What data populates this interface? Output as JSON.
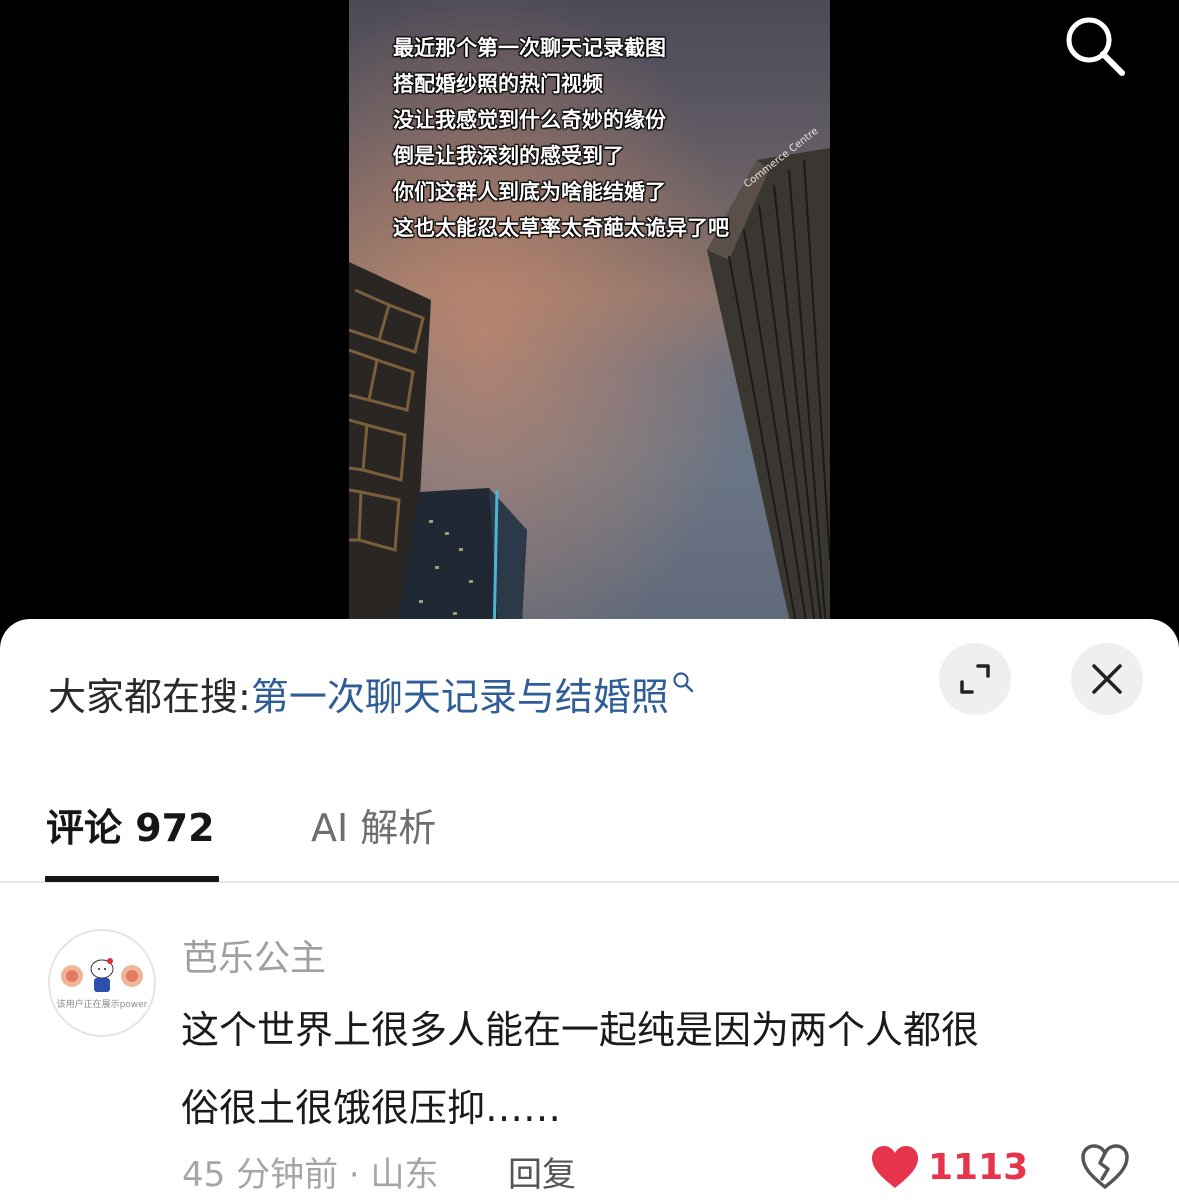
{
  "video": {
    "caption_lines": [
      "最近那个第一次聊天记录截图",
      "搭配婚纱照的热门视频",
      "没让我感觉到什么奇妙的缘份",
      "倒是让我深刻的感受到了",
      "你们这群人到底为啥能结婚了",
      "这也太能忍太草率太奇葩太诡异了吧"
    ],
    "building_sign": "Commerce Centre"
  },
  "search_bar": {
    "prefix": "大家都在搜:",
    "query": "第一次聊天记录与结婚照"
  },
  "tabs": {
    "comments_label": "评论 972",
    "ai_label": "AI 解析"
  },
  "comment": {
    "avatar_caption": "该用户正在展示power",
    "username": "芭乐公主",
    "text_line1": "这个世界上很多人能在一起纯是因为两个人都很",
    "text_line2": "俗很土很饿很压抑……",
    "meta": "45 分钟前 · 山东",
    "reply_label": "回复",
    "like_count": "1113"
  },
  "colors": {
    "accent_link": "#2f5e96",
    "like_red": "#e5344b"
  },
  "icons": [
    "search-icon",
    "expand-icon",
    "close-icon",
    "heart-icon",
    "broken-heart-icon"
  ]
}
